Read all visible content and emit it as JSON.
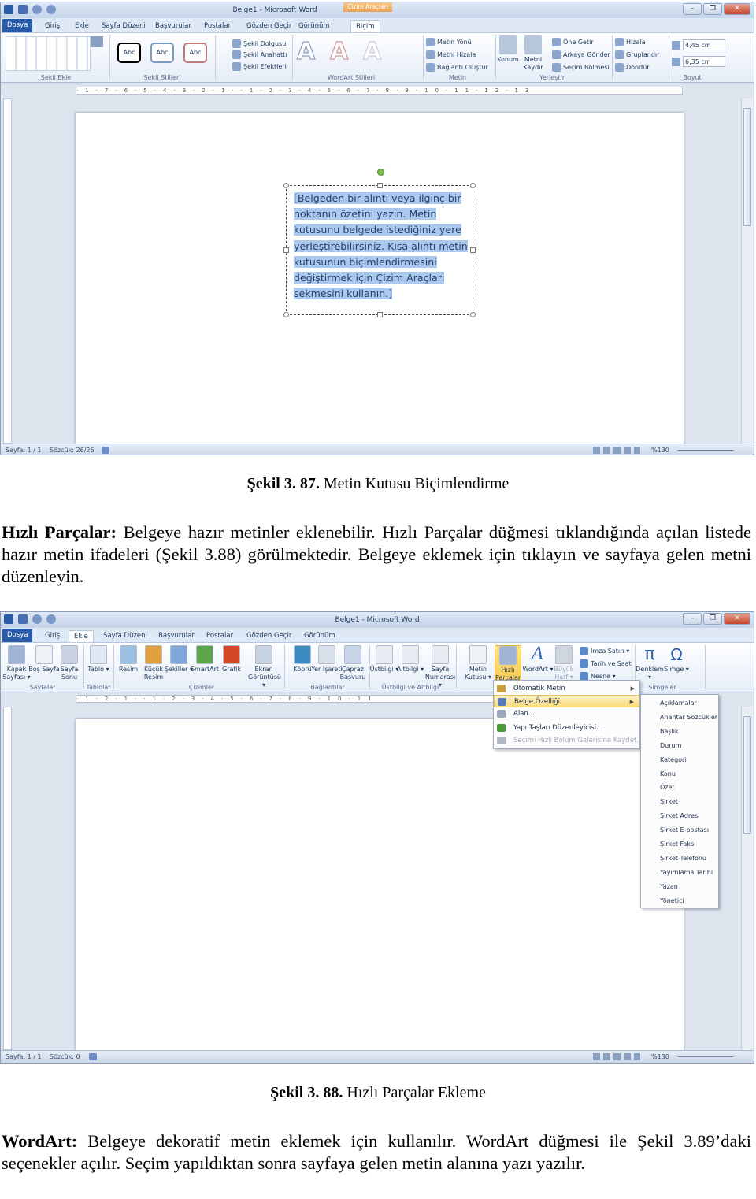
{
  "colors": {
    "ribbon_blue": "#2a5ba8",
    "selection": "#a9c9ee",
    "highlight": "#fbdd7e",
    "contextual_tab": "#e8a154"
  },
  "shot1": {
    "title": "Belge1 - Microsoft Word",
    "contextual_tab": "Çizim Araçları",
    "tabs": [
      "Dosya",
      "Giriş",
      "Ekle",
      "Sayfa Düzeni",
      "Başvurular",
      "Postalar",
      "Gözden Geçir",
      "Görünüm",
      "Biçim"
    ],
    "active_tab": "Biçim",
    "groups": [
      "Şekil Ekle",
      "Şekil Stilleri",
      "WordArt Stilleri",
      "Metin",
      "Yerleştir",
      "Boyut"
    ],
    "style_gallery": [
      "Abc",
      "Abc",
      "Abc"
    ],
    "wordart_gallery": [
      "A",
      "A",
      "A"
    ],
    "small_buttons": [
      "Şekil Dolgusu",
      "Şekil Anahattı",
      "Şekil Efektleri",
      "Metin Yönü",
      "Metni Hizala",
      "Bağlantı Oluştur",
      "Öne Getir",
      "Arkaya Gönder",
      "Seçim Bölmesi",
      "Hizala",
      "Gruplandır",
      "Döndür"
    ],
    "big_buttons": [
      "Konum",
      "Metni Kaydır"
    ],
    "size": {
      "height": "4,45 cm",
      "width": "6,35 cm"
    },
    "textbox_lines": [
      "[Belgeden bir alıntı veya ilginç bir",
      "noktanın özetini yazın. Metin",
      "kutusunu belgede istediğiniz yere",
      "yerleştirebilirsiniz. Kısa alıntı metin",
      "kutusunun biçimlendirmesini",
      "değiştirmek için Çizim Araçları",
      "sekmesini kullanın.]"
    ],
    "status": {
      "page": "Sayfa: 1 / 1",
      "words": "Sözcük: 26/26",
      "zoom": "%130"
    }
  },
  "caption1": {
    "label": "Şekil 3. 87.",
    "text": " Metin Kutusu Biçimlendirme"
  },
  "para1": {
    "term": "Hızlı Parçalar:",
    "text": " Belgeye hazır metinler eklenebilir. Hızlı Parçalar düğmesi tıklandığında açılan listede hazır metin ifadeleri (Şekil 3.88) görülmektedir. Belgeye eklemek için tıklayın ve sayfaya gelen metni düzenleyin."
  },
  "shot2": {
    "title": "Belge1 - Microsoft Word",
    "tabs": [
      "Dosya",
      "Giriş",
      "Ekle",
      "Sayfa Düzeni",
      "Başvurular",
      "Postalar",
      "Gözden Geçir",
      "Görünüm"
    ],
    "active_tab": "Ekle",
    "big_buttons": [
      {
        "label": "Kapak Sayfası ▾",
        "icon": "cover-page-icon"
      },
      {
        "label": "Boş Sayfa",
        "icon": "blank-page-icon"
      },
      {
        "label": "Sayfa Sonu",
        "icon": "page-break-icon"
      },
      {
        "label": "Tablo ▾",
        "icon": "table-icon"
      },
      {
        "label": "Resim",
        "icon": "picture-icon"
      },
      {
        "label": "Küçük Resim",
        "icon": "clip-art-icon"
      },
      {
        "label": "Şekiller ▾",
        "icon": "shapes-icon"
      },
      {
        "label": "SmartArt",
        "icon": "smartart-icon"
      },
      {
        "label": "Grafik",
        "icon": "chart-icon"
      },
      {
        "label": "Ekran Görüntüsü ▾",
        "icon": "screenshot-icon"
      },
      {
        "label": "Köprü",
        "icon": "hyperlink-icon"
      },
      {
        "label": "Yer İşareti",
        "icon": "bookmark-icon"
      },
      {
        "label": "Çapraz Başvuru",
        "icon": "cross-reference-icon"
      },
      {
        "label": "Üstbilgi ▾",
        "icon": "header-icon"
      },
      {
        "label": "Altbilgi ▾",
        "icon": "footer-icon"
      },
      {
        "label": "Sayfa Numarası ▾",
        "icon": "page-number-icon"
      },
      {
        "label": "Metin Kutusu ▾",
        "icon": "text-box-icon"
      },
      {
        "label": "Hızlı Parçalar ▾",
        "icon": "quick-parts-icon"
      },
      {
        "label": "WordArt ▾",
        "icon": "wordart-icon"
      },
      {
        "label": "Büyük Harf ▾",
        "icon": "drop-cap-icon"
      },
      {
        "label": "Denklem ▾",
        "icon": "equation-icon"
      },
      {
        "label": "Simge ▾",
        "icon": "symbol-icon"
      }
    ],
    "small_buttons": [
      "İmza Satırı ▾",
      "Tarih ve Saat",
      "Nesne ▾"
    ],
    "groups": [
      "Sayfalar",
      "Tablolar",
      "Çizimler",
      "Bağlantılar",
      "Üstbilgi ve Altbilgi",
      "Simgeler"
    ],
    "menu": [
      {
        "label": "Otomatik Metin",
        "submenu": true
      },
      {
        "label": "Belge Özelliği",
        "submenu": true,
        "selected": true
      },
      {
        "label": "Alan..."
      },
      {
        "label": "Yapı Taşları Düzenleyicisi..."
      },
      {
        "label": "Seçimi Hızlı Bölüm Galerisine Kaydet...",
        "disabled": true
      }
    ],
    "submenu": [
      "Açıklamalar",
      "Anahtar Sözcükler",
      "Başlık",
      "Durum",
      "Kategori",
      "Konu",
      "Özet",
      "Şirket",
      "Şirket Adresi",
      "Şirket E-postası",
      "Şirket Faksı",
      "Şirket Telefonu",
      "Yayımlama Tarihi",
      "Yazan",
      "Yönetici"
    ],
    "status": {
      "page": "Sayfa: 1 / 1",
      "words": "Sözcük: 0",
      "zoom": "%130"
    }
  },
  "caption2": {
    "label": "Şekil 3. 88.",
    "text": " Hızlı Parçalar Ekleme"
  },
  "para2": {
    "term": "WordArt:",
    "text": " Belgeye dekoratif metin eklemek için kullanılır. WordArt düğmesi ile Şekil 3.89’daki seçenekler açılır. Seçim yapıldıktan sonra sayfaya gelen metin alanına yazı yazılır."
  }
}
